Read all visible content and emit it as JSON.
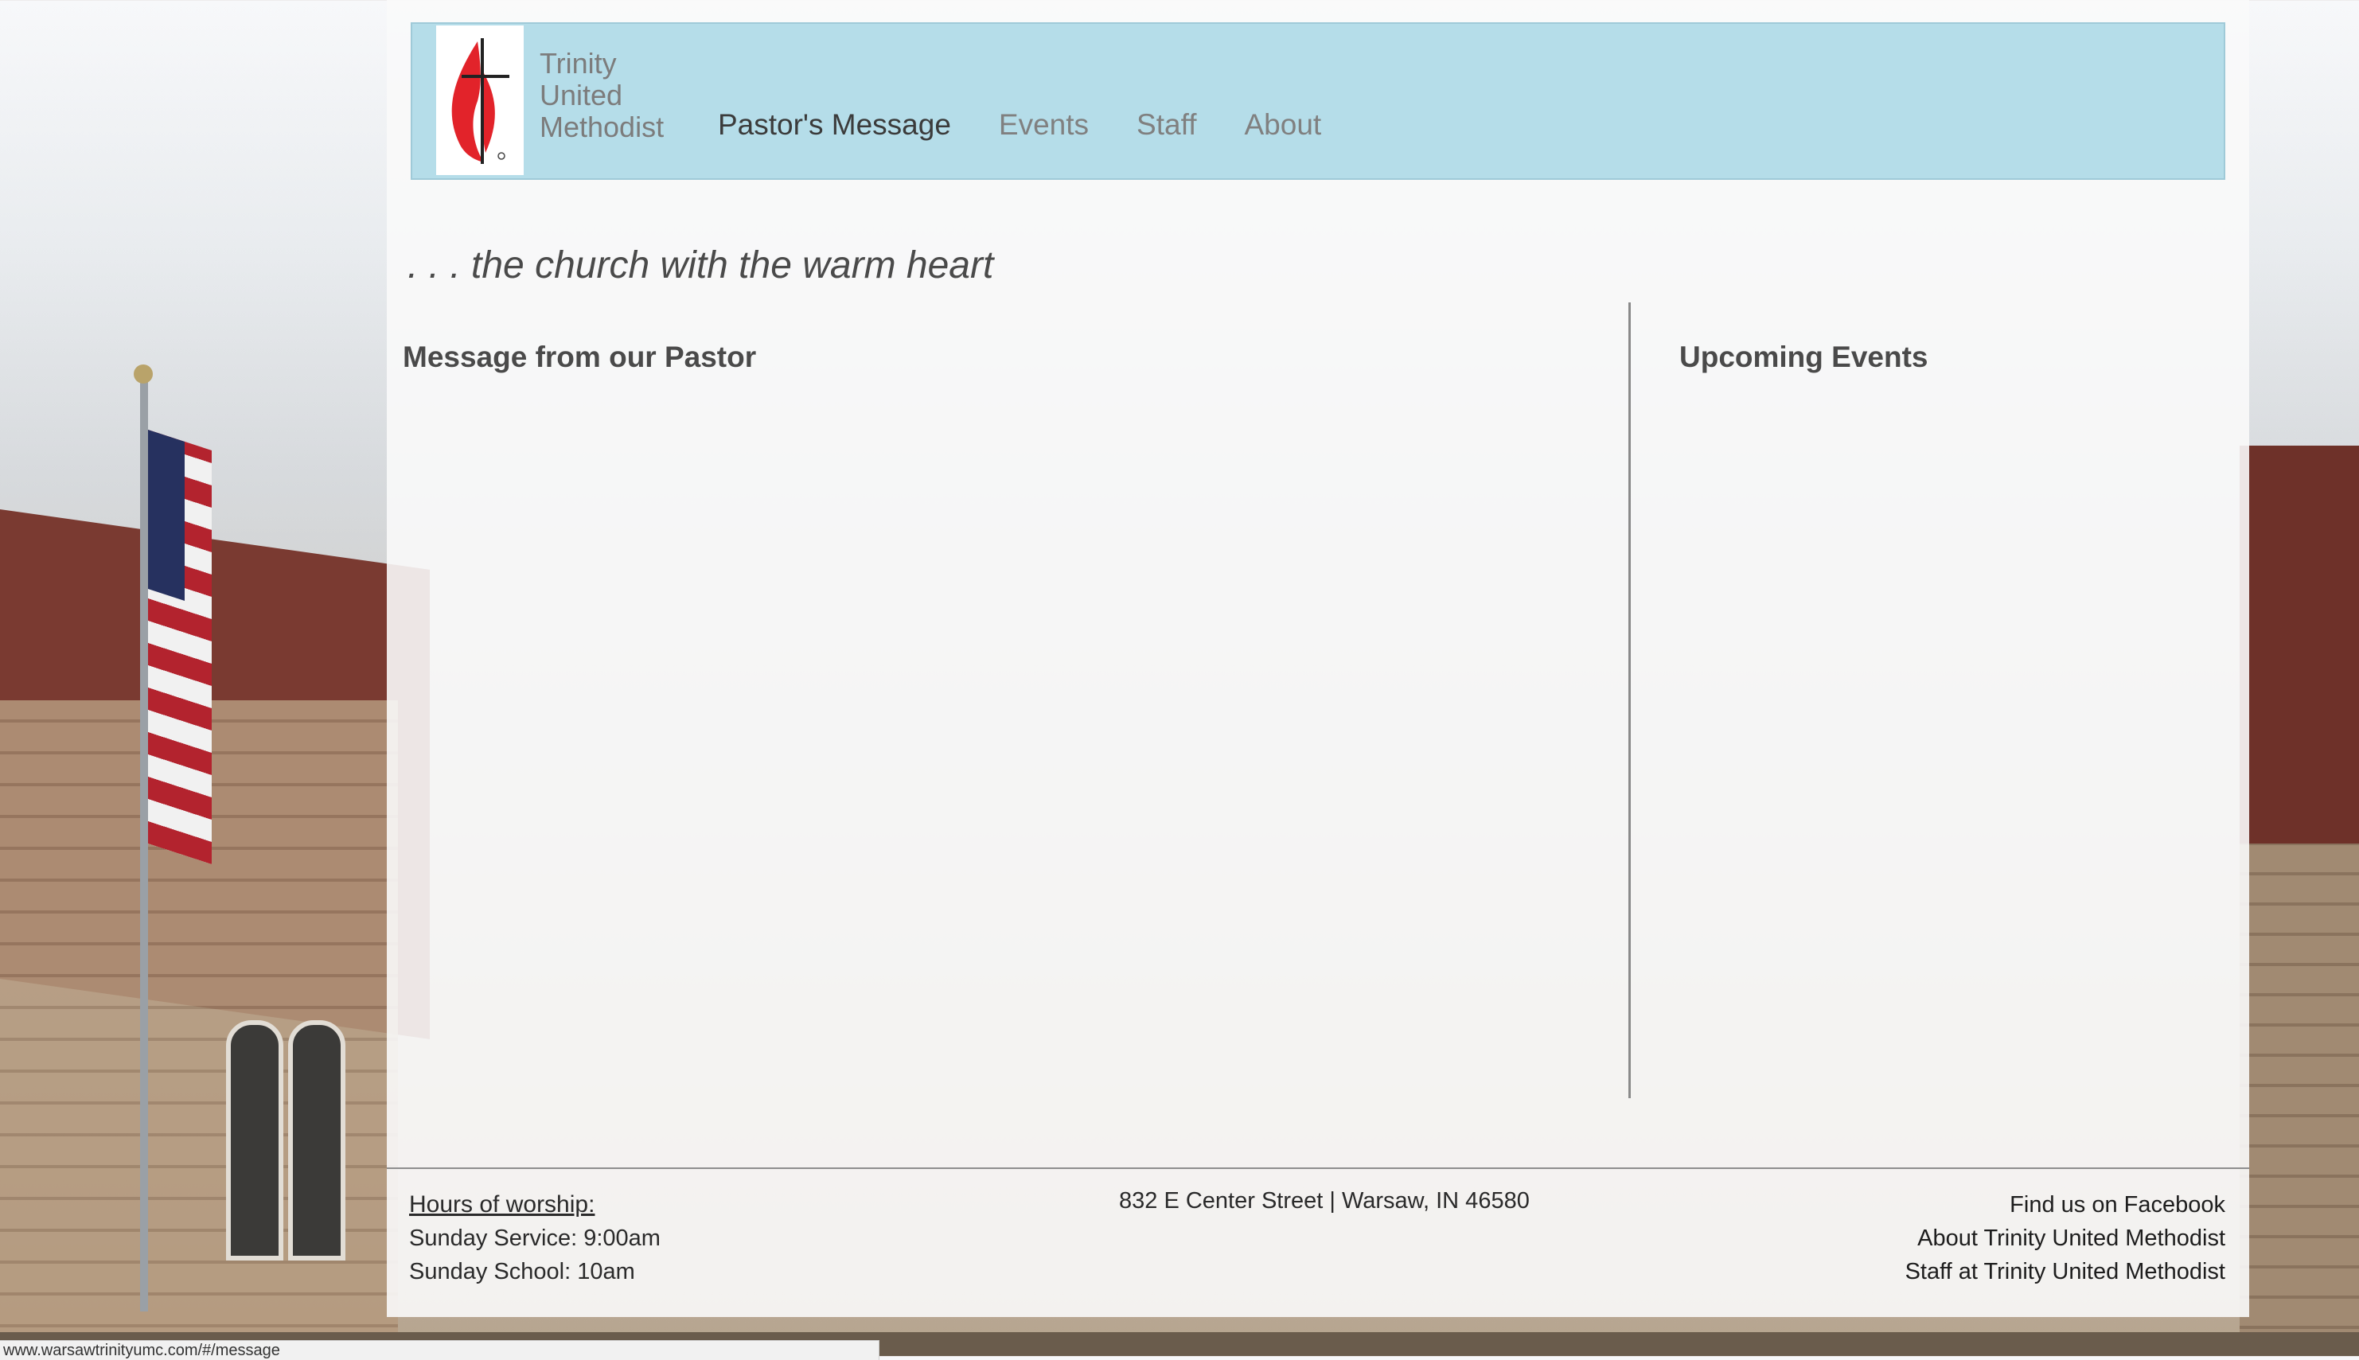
{
  "header": {
    "logo_icon": "cross-and-flame-icon",
    "brand_lines": [
      "Trinity",
      "United",
      "Methodist"
    ],
    "nav": [
      {
        "label": "Pastor's Message",
        "active": true
      },
      {
        "label": "Events",
        "active": false
      },
      {
        "label": "Staff",
        "active": false
      },
      {
        "label": "About",
        "active": false
      }
    ],
    "colors": {
      "header_bg": "#b5dde9",
      "logo_red": "#e2232a"
    }
  },
  "main": {
    "tagline": ". . . the church with the warm heart",
    "left_title": "Message from our Pastor",
    "right_title": "Upcoming Events"
  },
  "footer": {
    "hours_heading": "Hours of worship:",
    "hours_lines": [
      "Sunday Service: 9:00am",
      "Sunday School: 10am"
    ],
    "address": "832 E Center Street | Warsaw, IN 46580",
    "links": [
      "Find us on Facebook",
      "About Trinity United Methodist",
      "Staff at Trinity United Methodist"
    ]
  },
  "status_bar": {
    "url": "www.warsawtrinityumc.com/#/message"
  }
}
